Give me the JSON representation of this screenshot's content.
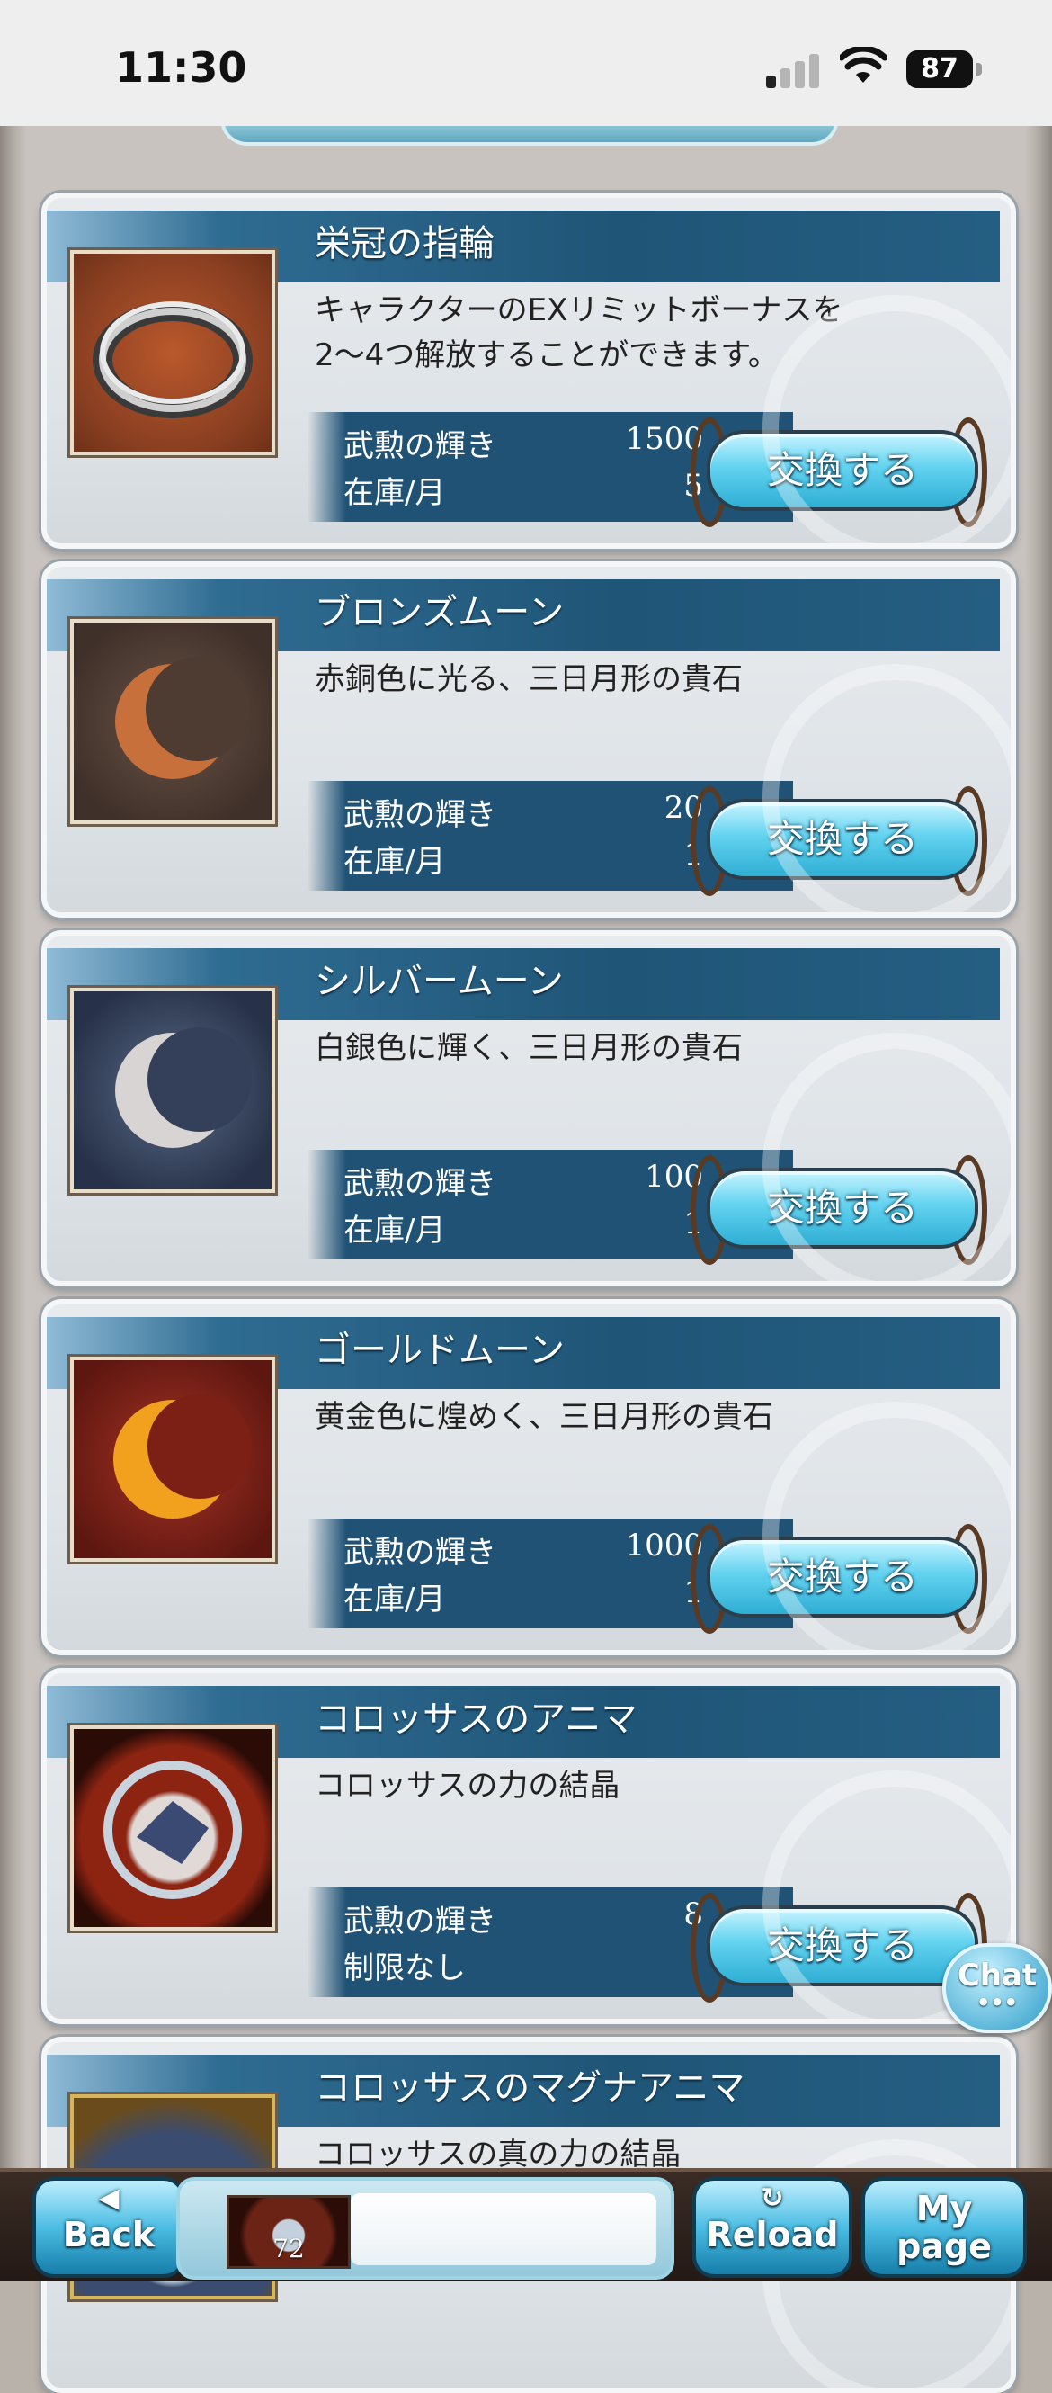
{
  "status_bar": {
    "time": "11:30",
    "battery": "87"
  },
  "labels": {
    "cost_label": "武勲の輝き",
    "button_label": "交換する"
  },
  "items": [
    {
      "name": "栄冠の指輪",
      "desc": "キャラクターのEXリミットボーナスを\n2〜4つ解放することができます。",
      "cost": "1500",
      "stock_label": "在庫/月",
      "stock": "5",
      "thumb": "ring-icon"
    },
    {
      "name": "ブロンズムーン",
      "desc": "赤銅色に光る、三日月形の貴石",
      "cost": "20",
      "stock_label": "在庫/月",
      "stock": "1",
      "thumb": "bronze-moon-icon"
    },
    {
      "name": "シルバームーン",
      "desc": "白銀色に輝く、三日月形の貴石",
      "cost": "100",
      "stock_label": "在庫/月",
      "stock": "1",
      "thumb": "silver-moon-icon"
    },
    {
      "name": "ゴールドムーン",
      "desc": "黄金色に煌めく、三日月形の貴石",
      "cost": "1000",
      "stock_label": "在庫/月",
      "stock": "1",
      "thumb": "gold-moon-icon"
    },
    {
      "name": "コロッサスのアニマ",
      "desc": "コロッサスの力の結晶",
      "cost": "8",
      "stock_label": "制限なし",
      "stock": "",
      "thumb": "colossus-anima-icon"
    },
    {
      "name": "コロッサスのマグナアニマ",
      "desc": "コロッサスの真の力の結晶",
      "cost": "",
      "stock_label": "",
      "stock": "",
      "thumb": "colossus-magna-anima-icon"
    }
  ],
  "chat": {
    "label": "Chat",
    "dots": "•••"
  },
  "nav": {
    "back": "Back",
    "reload": "Reload",
    "mypage_line1": "My",
    "mypage_line2": "page",
    "avatar_level": "72"
  },
  "colors": {
    "title_bar": "#1f5577",
    "info_bg": "#1f5274",
    "button": "#4cc6ea"
  }
}
